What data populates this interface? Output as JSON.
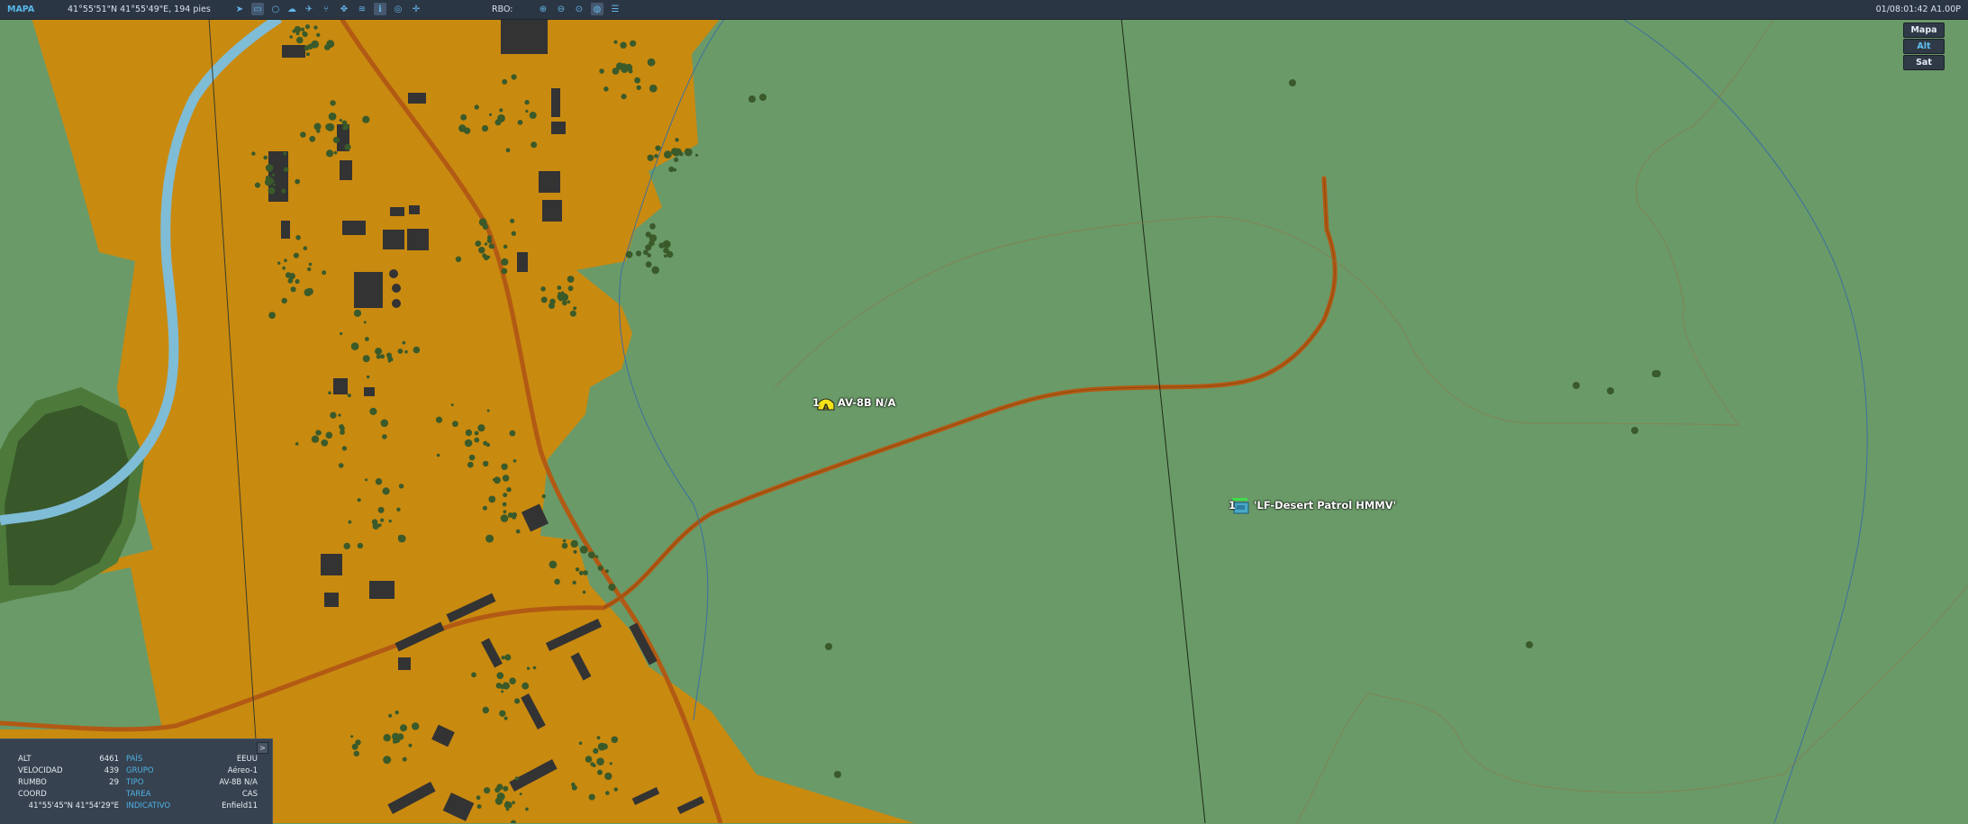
{
  "toolbar": {
    "mode": "MAPA",
    "cursor_coords": "41°55'51\"N 41°55'49\"E, 194 pies",
    "rbo_label": "RBO:",
    "clock": "01/08:01:42 A1.00P"
  },
  "map_types": [
    "Mapa",
    "Alt",
    "Sat"
  ],
  "selected_map_type": "Alt",
  "units": [
    {
      "count": "1",
      "name": "AV-8B N/A",
      "icon": "aircraft-yellow-a-icon",
      "letter": "A"
    },
    {
      "count": "1",
      "name": "'LF-Desert Patrol HMMV'",
      "icon": "ground-vehicle-icon"
    }
  ],
  "info_panel": {
    "close_label": ">",
    "left": [
      {
        "label": "ALT",
        "value": "6461"
      },
      {
        "label": "VELOCIDAD",
        "value": "439"
      },
      {
        "label": "RUMBO",
        "value": "29"
      },
      {
        "label": "COORD",
        "value": ""
      }
    ],
    "coord_value": "41°55'45\"N 41°54'29\"E",
    "right": [
      {
        "label": "PAÍS",
        "value": "EEUU"
      },
      {
        "label": "GRUPO",
        "value": "Aéreo-1"
      },
      {
        "label": "TIPO",
        "value": "AV-8B N/A"
      },
      {
        "label": "TAREA",
        "value": "CAS"
      },
      {
        "label": "INDICATIVO",
        "value": "Enfield11"
      }
    ]
  },
  "colors": {
    "terrain": "#6a9a68",
    "urban": "#c98a10",
    "road": "#b25a14",
    "river": "#7fbcd6",
    "forest": "#3a5a2a",
    "building": "#333333",
    "toolbar": "#2b3644",
    "accent": "#58b8ea"
  }
}
